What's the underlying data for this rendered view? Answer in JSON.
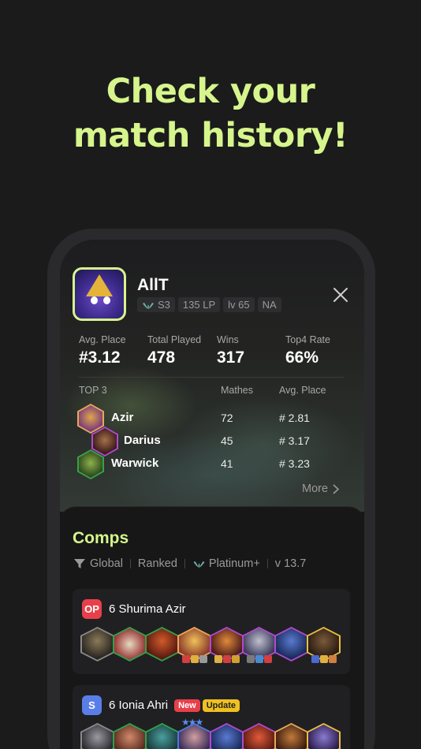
{
  "headline": {
    "line1": "Check your",
    "line2": "match history!"
  },
  "profile": {
    "name": "AllT",
    "tags": [
      "S3",
      "135 LP",
      "lv 65",
      "NA"
    ]
  },
  "stats": [
    {
      "label": "Avg. Place",
      "value": "#3.12"
    },
    {
      "label": "Total Played",
      "value": "478"
    },
    {
      "label": "Wins",
      "value": "317"
    },
    {
      "label": "Top4 Rate",
      "value": "66%"
    }
  ],
  "top3": {
    "header": "TOP 3",
    "col_matches": "Mathes",
    "col_avg": "Avg. Place",
    "rows": [
      {
        "name": "Azir",
        "matches": "72",
        "avg": "# 2.81"
      },
      {
        "name": "Darius",
        "matches": "45",
        "avg": "# 3.17"
      },
      {
        "name": "Warwick",
        "matches": "41",
        "avg": "# 3.23"
      }
    ]
  },
  "more_label": "More",
  "comps": {
    "title": "Comps",
    "filters": [
      "Global",
      "Ranked",
      "Platinum+",
      "v 13.7"
    ],
    "cards": [
      {
        "tier": "OP",
        "tier_color": "#e8404a",
        "name": "6 Shurima Azir",
        "badges": []
      },
      {
        "tier": "S",
        "tier_color": "#5a7ee8",
        "name": "6 Ionia Ahri",
        "badges": [
          "New",
          "Update"
        ]
      }
    ]
  },
  "colors": {
    "accent": "#d6f58c",
    "background": "#1b1b1b"
  }
}
